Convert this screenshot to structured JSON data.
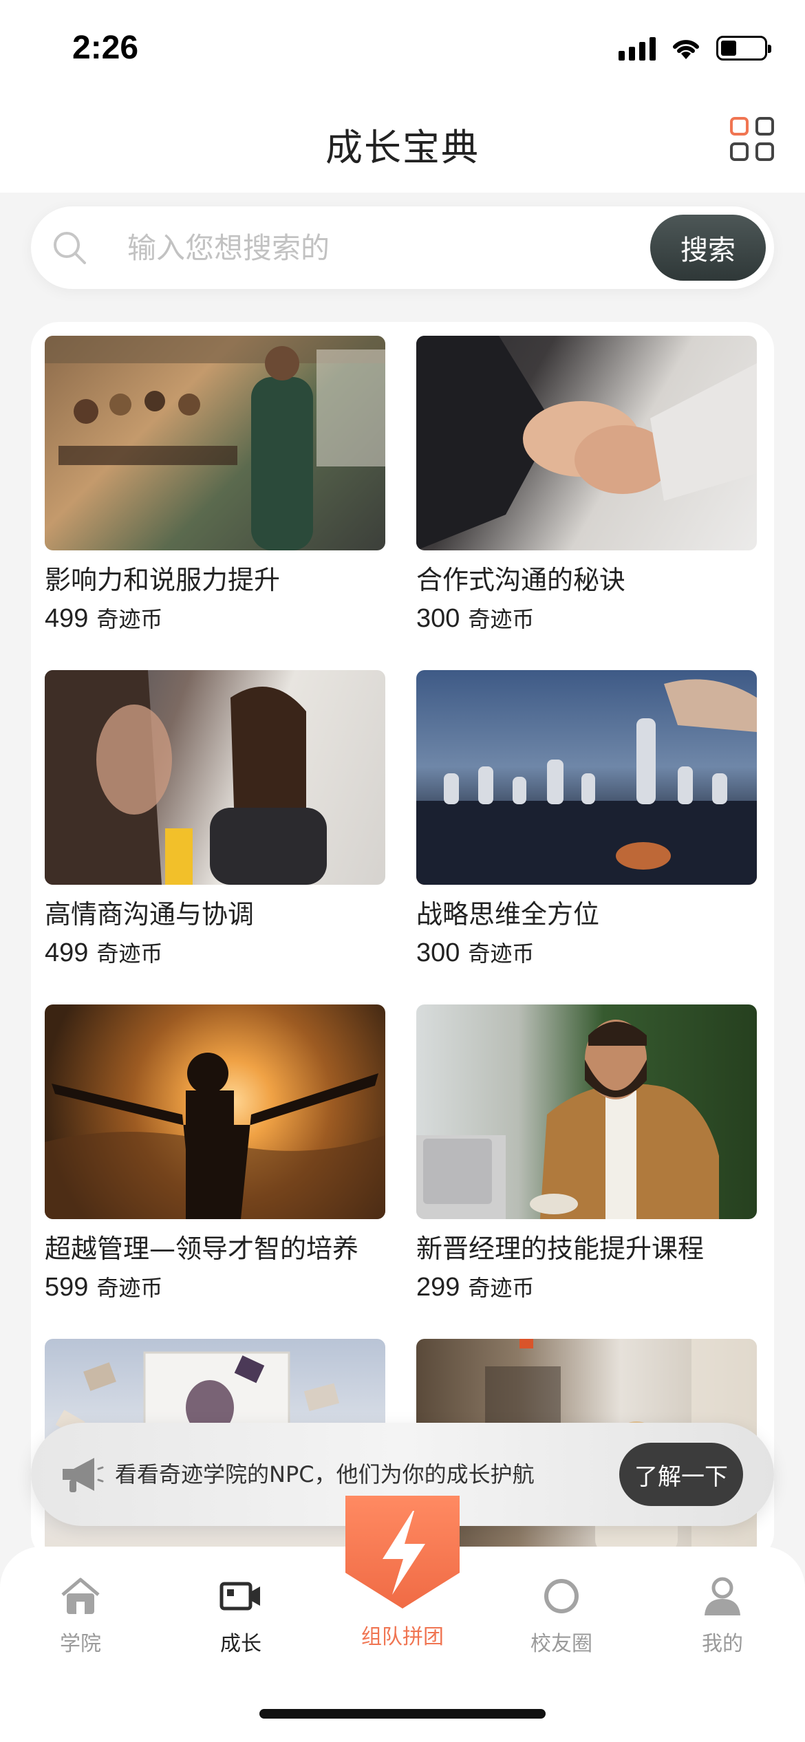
{
  "status_bar": {
    "time": "2:26",
    "battery_level": 0.3
  },
  "header": {
    "title": "成长宝典",
    "menu_icon": "grid-menu-icon"
  },
  "search": {
    "placeholder": "输入您想搜索的",
    "button_label": "搜索"
  },
  "courses": [
    {
      "title": "影响力和说服力提升",
      "price": "499",
      "unit": "奇迹币",
      "image": "team-meeting-photo"
    },
    {
      "title": "合作式沟通的秘诀",
      "price": "300",
      "unit": "奇迹币",
      "image": "holding-hands-photo"
    },
    {
      "title": "高情商沟通与协调",
      "price": "499",
      "unit": "奇迹币",
      "image": "conversation-photo"
    },
    {
      "title": "战略思维全方位",
      "price": "300",
      "unit": "奇迹币",
      "image": "chess-photo"
    },
    {
      "title": "超越管理—领导才智的培养",
      "price": "599",
      "unit": "奇迹币",
      "image": "sunrise-silhouette-photo"
    },
    {
      "title": "新晋经理的技能提升课程",
      "price": "299",
      "unit": "奇迹币",
      "image": "thumbs-up-laptop-photo"
    },
    {
      "title": "",
      "price": "",
      "unit": "",
      "image": "flying-books-photo"
    },
    {
      "title": "",
      "price": "",
      "unit": "",
      "image": "cafe-woman-photo"
    }
  ],
  "banner": {
    "text": "看看奇迹学院的NPC，他们为你的成长护航",
    "button_label": "了解一下"
  },
  "tabs": [
    {
      "label": "学院",
      "icon": "home-icon",
      "state": "inactive"
    },
    {
      "label": "成长",
      "icon": "video-camera-icon",
      "state": "active"
    },
    {
      "label": "组队拼团",
      "icon": "lightning-icon",
      "state": "accent"
    },
    {
      "label": "校友圈",
      "icon": "circle-icon",
      "state": "inactive"
    },
    {
      "label": "我的",
      "icon": "user-icon",
      "state": "inactive"
    }
  ],
  "colors": {
    "accent": "#f07552",
    "dark_button": "#3c3c3c",
    "background": "#f4f4f4"
  }
}
